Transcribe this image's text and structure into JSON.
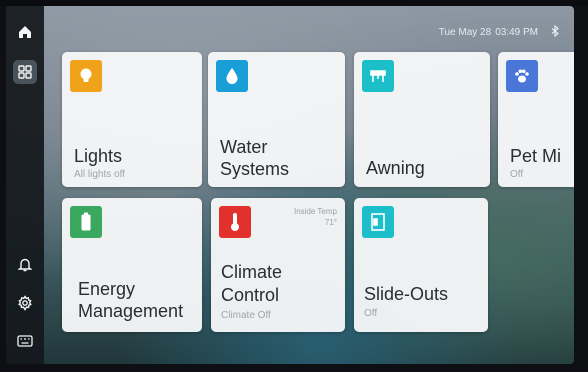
{
  "statusbar": {
    "date": "Tue May 28",
    "time": "03:49 PM"
  },
  "nav": [
    "home-icon",
    "dashboard-grid-icon",
    "bell-icon",
    "gear-icon",
    "keyboard-icon"
  ],
  "tiles": [
    {
      "title": "Lights",
      "subtitle": "All lights off",
      "color": "#f0a21a",
      "icon": "lightbulb-icon"
    },
    {
      "title_line1": "Water",
      "title_line2": "Systems",
      "color": "#1a9ed8",
      "icon": "water-drop-icon"
    },
    {
      "title": "Awning",
      "color": "#1cbfc9",
      "icon": "awning-icon"
    },
    {
      "title": "Pet Mi",
      "subtitle": "Off",
      "color": "#4a76d8",
      "icon": "paw-icon"
    },
    {
      "title_line1": "Energy",
      "title_line2": "Management",
      "color": "#3aa85e",
      "icon": "battery-icon"
    },
    {
      "title_line1": "Climate",
      "title_line2": "Control",
      "subtitle": "Climate Off",
      "corner_label": "Inside Temp",
      "corner_value": "71°",
      "color": "#e2312d",
      "icon": "thermometer-icon"
    },
    {
      "title": "Slide-Outs",
      "subtitle": "Off",
      "color": "#1cbfc9",
      "icon": "slide-out-icon"
    }
  ]
}
